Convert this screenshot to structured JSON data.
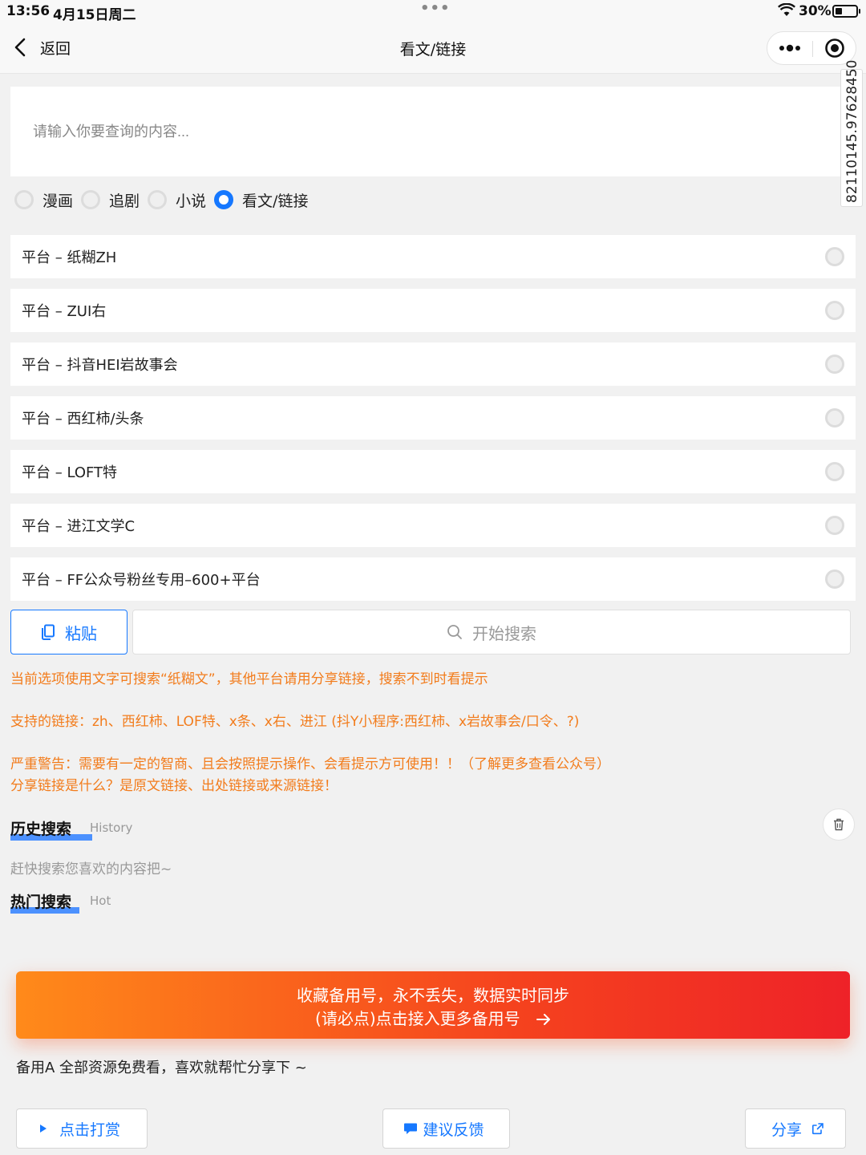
{
  "status_bar": {
    "time": "13:56",
    "date": "4月15日周二",
    "battery": "30%"
  },
  "nav": {
    "back_label": "返回",
    "title": "看文/链接"
  },
  "watermark": "82110145.97628450",
  "search": {
    "placeholder": "请输入你要查询的内容..."
  },
  "types": [
    {
      "label": "漫画",
      "selected": false
    },
    {
      "label": "追剧",
      "selected": false
    },
    {
      "label": "小说",
      "selected": false
    },
    {
      "label": "看文/链接",
      "selected": true
    }
  ],
  "platforms": [
    "平台 – 纸糊ZH",
    "平台 – ZUI右",
    "平台 – 抖音HEI岩故事会",
    "平台 – 西红柿/头条",
    "平台 – LOFT特",
    "平台 – 进江文学C",
    "平台 – FF公众号粉丝专用–600+平台"
  ],
  "actions": {
    "paste_label": "粘贴",
    "search_label": "开始搜索"
  },
  "notices": {
    "line1": "当前选项使用文字可搜索“纸糊文”，其他平台请用分享链接，搜索不到时看提示",
    "line2": "支持的链接：zh、西红柿、LOF特、x条、x右、进江 (抖Y小程序:西红柿、x岩故事会/口令、?)",
    "line3": "严重警告：需要有一定的智商、且会按照提示操作、会看提示方可使用！！（了解更多查看公众号）",
    "line4": "分享链接是什么？是原文链接、出处链接或来源链接！"
  },
  "history": {
    "title": "历史搜索",
    "sub": "History",
    "empty": "赶快搜索您喜欢的内容把~"
  },
  "hot": {
    "title": "热门搜索",
    "sub": "Hot"
  },
  "banner": {
    "line1": "收藏备用号，永不丢失，数据实时同步",
    "line2": "(请必点)点击接入更多备用号"
  },
  "share_note": "备用A 全部资源免费看，喜欢就帮忙分享下 ~",
  "bottom": {
    "reward": "点击打赏",
    "feedback": "建议反馈",
    "share": "分享"
  },
  "colors": {
    "accent": "#1678ff",
    "notice": "#f27c1c",
    "banner_start": "#ff8a1a",
    "banner_end": "#ee2228"
  }
}
